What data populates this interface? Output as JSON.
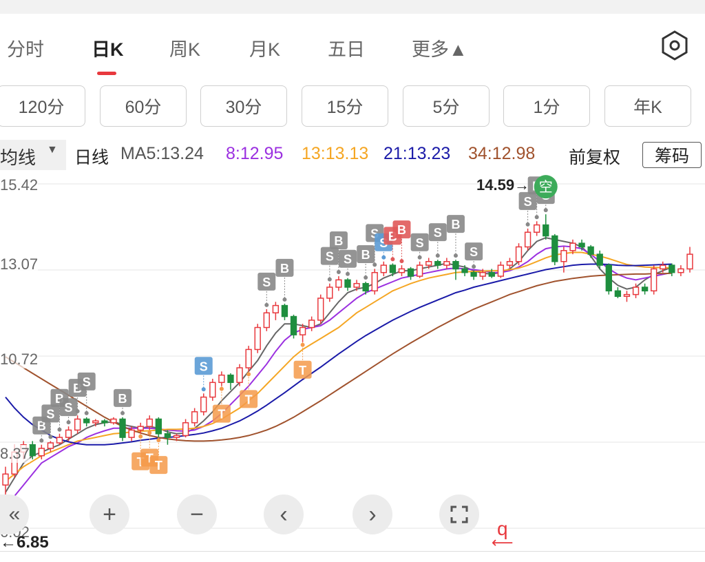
{
  "tabs": [
    "分时",
    "日K",
    "周K",
    "月K",
    "五日",
    "更多▲"
  ],
  "settings_icon": "hexagon-gear-icon",
  "minute_buttons": [
    "120分",
    "60分",
    "30分",
    "15分",
    "5分",
    "1分",
    "年K"
  ],
  "ma_bar": {
    "indicator": "均线",
    "period": "日线",
    "ma5": "MA5:13.24",
    "ma8": "8:12.95",
    "ma13": "13:13.13",
    "ma21": "21:13.23",
    "ma34": "34:12.98",
    "adjust": "前复权",
    "chips_button": "筹码"
  },
  "colors": {
    "ma5": "#666666",
    "ma8": "#9b30e0",
    "ma13": "#f5a623",
    "ma21": "#1a1aa8",
    "ma34": "#a0522d",
    "up": "#e8383d",
    "down": "#1e8e3e",
    "accent": "#e8383d"
  },
  "axis_labels": [
    "15.42",
    "13.07",
    "10.72",
    "8.37",
    "6.02"
  ],
  "high_price": "14.59→",
  "low_price": "←6.85",
  "signal_kong": "空",
  "q_label": "q",
  "nav": {
    "first": "«",
    "zoom_in": "+",
    "zoom_out": "−",
    "prev": "‹",
    "next": "›",
    "fullscreen": "⛶"
  },
  "chart_data": {
    "type": "candlestick",
    "y_range": [
      6.02,
      15.42
    ],
    "ticks": [
      15.42,
      13.07,
      10.72,
      8.37,
      6.02
    ],
    "high": 14.59,
    "low": 6.85,
    "candles": [
      {
        "o": 7.2,
        "c": 7.5,
        "h": 7.7,
        "l": 6.85
      },
      {
        "o": 7.5,
        "c": 8.1,
        "h": 8.3,
        "l": 7.4
      },
      {
        "o": 8.1,
        "c": 8.3,
        "h": 8.4,
        "l": 7.9
      },
      {
        "o": 8.3,
        "c": 8.0,
        "h": 8.4,
        "l": 7.9
      },
      {
        "o": 8.0,
        "c": 8.2,
        "h": 8.3,
        "l": 7.9
      },
      {
        "o": 8.2,
        "c": 8.35,
        "h": 8.4,
        "l": 8.1
      },
      {
        "o": 8.35,
        "c": 8.5,
        "h": 8.6,
        "l": 8.3
      },
      {
        "o": 8.5,
        "c": 8.7,
        "h": 8.8,
        "l": 8.4
      },
      {
        "o": 8.7,
        "c": 9.0,
        "h": 9.1,
        "l": 8.6
      },
      {
        "o": 9.0,
        "c": 8.9,
        "h": 9.05,
        "l": 8.8
      },
      {
        "o": 8.9,
        "c": 8.95,
        "h": 9.0,
        "l": 8.8
      },
      {
        "o": 8.95,
        "c": 8.9,
        "h": 9.0,
        "l": 8.8
      },
      {
        "o": 8.9,
        "c": 9.0,
        "h": 9.05,
        "l": 8.85
      },
      {
        "o": 9.0,
        "c": 8.5,
        "h": 9.05,
        "l": 8.4
      },
      {
        "o": 8.5,
        "c": 8.7,
        "h": 8.8,
        "l": 8.4
      },
      {
        "o": 8.7,
        "c": 8.8,
        "h": 8.9,
        "l": 8.6
      },
      {
        "o": 8.8,
        "c": 9.0,
        "h": 9.1,
        "l": 8.7
      },
      {
        "o": 9.0,
        "c": 8.6,
        "h": 9.05,
        "l": 8.5
      },
      {
        "o": 8.6,
        "c": 8.5,
        "h": 8.7,
        "l": 8.3
      },
      {
        "o": 8.5,
        "c": 8.55,
        "h": 8.6,
        "l": 8.4
      },
      {
        "o": 8.55,
        "c": 8.9,
        "h": 9.0,
        "l": 8.5
      },
      {
        "o": 8.9,
        "c": 9.2,
        "h": 9.3,
        "l": 8.8
      },
      {
        "o": 9.2,
        "c": 9.6,
        "h": 9.7,
        "l": 9.1
      },
      {
        "o": 9.6,
        "c": 10.0,
        "h": 10.1,
        "l": 9.5
      },
      {
        "o": 10.0,
        "c": 10.2,
        "h": 10.3,
        "l": 9.9
      },
      {
        "o": 10.2,
        "c": 10.0,
        "h": 10.25,
        "l": 9.8
      },
      {
        "o": 10.0,
        "c": 10.4,
        "h": 10.5,
        "l": 9.9
      },
      {
        "o": 10.4,
        "c": 10.9,
        "h": 11.0,
        "l": 10.3
      },
      {
        "o": 10.9,
        "c": 11.5,
        "h": 11.6,
        "l": 10.8
      },
      {
        "o": 11.5,
        "c": 11.9,
        "h": 12.0,
        "l": 11.4
      },
      {
        "o": 11.9,
        "c": 12.1,
        "h": 12.2,
        "l": 11.7
      },
      {
        "o": 12.1,
        "c": 11.8,
        "h": 12.15,
        "l": 11.7
      },
      {
        "o": 11.8,
        "c": 11.3,
        "h": 11.85,
        "l": 11.2
      },
      {
        "o": 11.3,
        "c": 11.5,
        "h": 11.6,
        "l": 11.1
      },
      {
        "o": 11.5,
        "c": 11.7,
        "h": 11.8,
        "l": 11.4
      },
      {
        "o": 11.7,
        "c": 12.3,
        "h": 12.4,
        "l": 11.6
      },
      {
        "o": 12.3,
        "c": 12.6,
        "h": 12.7,
        "l": 12.2
      },
      {
        "o": 12.6,
        "c": 12.8,
        "h": 12.9,
        "l": 12.5
      },
      {
        "o": 12.8,
        "c": 12.6,
        "h": 12.85,
        "l": 12.5
      },
      {
        "o": 12.6,
        "c": 12.7,
        "h": 12.8,
        "l": 12.5
      },
      {
        "o": 12.7,
        "c": 12.5,
        "h": 12.75,
        "l": 12.4
      },
      {
        "o": 12.5,
        "c": 13.0,
        "h": 13.1,
        "l": 12.4
      },
      {
        "o": 13.0,
        "c": 13.2,
        "h": 13.3,
        "l": 12.9
      },
      {
        "o": 13.2,
        "c": 13.0,
        "h": 13.25,
        "l": 12.9
      },
      {
        "o": 13.0,
        "c": 13.1,
        "h": 13.2,
        "l": 12.9
      },
      {
        "o": 13.1,
        "c": 12.9,
        "h": 13.15,
        "l": 12.8
      },
      {
        "o": 12.9,
        "c": 13.2,
        "h": 13.3,
        "l": 12.85
      },
      {
        "o": 13.2,
        "c": 13.3,
        "h": 13.4,
        "l": 13.1
      },
      {
        "o": 13.3,
        "c": 13.2,
        "h": 13.35,
        "l": 13.1
      },
      {
        "o": 13.2,
        "c": 13.3,
        "h": 13.4,
        "l": 13.1
      },
      {
        "o": 13.3,
        "c": 13.1,
        "h": 13.35,
        "l": 12.8
      },
      {
        "o": 13.1,
        "c": 13.0,
        "h": 13.2,
        "l": 12.9
      },
      {
        "o": 13.0,
        "c": 12.9,
        "h": 13.05,
        "l": 12.8
      },
      {
        "o": 12.9,
        "c": 13.0,
        "h": 13.1,
        "l": 12.8
      },
      {
        "o": 13.0,
        "c": 12.9,
        "h": 13.1,
        "l": 12.85
      },
      {
        "o": 12.9,
        "c": 13.2,
        "h": 13.3,
        "l": 12.85
      },
      {
        "o": 13.2,
        "c": 13.3,
        "h": 13.4,
        "l": 13.1
      },
      {
        "o": 13.3,
        "c": 13.7,
        "h": 13.8,
        "l": 13.2
      },
      {
        "o": 13.7,
        "c": 14.1,
        "h": 14.2,
        "l": 13.6
      },
      {
        "o": 14.1,
        "c": 14.3,
        "h": 14.4,
        "l": 14.0
      },
      {
        "o": 14.3,
        "c": 14.0,
        "h": 14.59,
        "l": 13.9
      },
      {
        "o": 14.0,
        "c": 13.3,
        "h": 14.05,
        "l": 13.2
      },
      {
        "o": 13.3,
        "c": 13.6,
        "h": 13.7,
        "l": 13.0
      },
      {
        "o": 13.6,
        "c": 13.8,
        "h": 13.9,
        "l": 13.5
      },
      {
        "o": 13.8,
        "c": 13.7,
        "h": 13.9,
        "l": 13.6
      },
      {
        "o": 13.7,
        "c": 13.5,
        "h": 13.75,
        "l": 13.4
      },
      {
        "o": 13.5,
        "c": 13.2,
        "h": 13.6,
        "l": 13.1
      },
      {
        "o": 13.2,
        "c": 12.5,
        "h": 13.25,
        "l": 12.4
      },
      {
        "o": 12.5,
        "c": 12.35,
        "h": 12.6,
        "l": 12.3
      },
      {
        "o": 12.35,
        "c": 12.4,
        "h": 12.5,
        "l": 12.2
      },
      {
        "o": 12.4,
        "c": 12.6,
        "h": 12.7,
        "l": 12.3
      },
      {
        "o": 12.6,
        "c": 12.5,
        "h": 12.7,
        "l": 12.4
      },
      {
        "o": 12.5,
        "c": 13.1,
        "h": 13.2,
        "l": 12.4
      },
      {
        "o": 13.1,
        "c": 13.2,
        "h": 13.3,
        "l": 13.0
      },
      {
        "o": 13.2,
        "c": 13.0,
        "h": 13.25,
        "l": 12.9
      },
      {
        "o": 13.0,
        "c": 13.1,
        "h": 13.2,
        "l": 12.9
      },
      {
        "o": 13.1,
        "c": 13.5,
        "h": 13.7,
        "l": 13.0
      }
    ],
    "ma_lines": [
      {
        "name": "MA5",
        "values": [
          7.0,
          7.4,
          7.8,
          8.0,
          8.1,
          8.2,
          8.3,
          8.45,
          8.6,
          8.75,
          8.85,
          8.9,
          8.93,
          8.85,
          8.8,
          8.75,
          8.8,
          8.75,
          8.65,
          8.6,
          8.62,
          8.75,
          8.95,
          9.2,
          9.5,
          9.75,
          10.0,
          10.3,
          10.6,
          11.0,
          11.35,
          11.6,
          11.6,
          11.55,
          11.5,
          11.6,
          11.9,
          12.2,
          12.45,
          12.55,
          12.6,
          12.7,
          12.85,
          12.95,
          13.05,
          13.05,
          13.1,
          13.15,
          13.2,
          13.25,
          13.2,
          13.15,
          13.05,
          12.98,
          12.96,
          13.0,
          13.1,
          13.3,
          13.6,
          13.85,
          13.95,
          13.9,
          13.85,
          13.8,
          13.7,
          13.45,
          13.1,
          12.85,
          12.65,
          12.55,
          12.6,
          12.8,
          12.95,
          13.05,
          13.15
        ]
      },
      {
        "name": "MA8",
        "values": [
          6.6,
          6.9,
          7.2,
          7.5,
          7.8,
          7.95,
          8.1,
          8.25,
          8.35,
          8.5,
          8.6,
          8.68,
          8.75,
          8.75,
          8.75,
          8.75,
          8.75,
          8.73,
          8.7,
          8.68,
          8.67,
          8.7,
          8.8,
          8.95,
          9.15,
          9.4,
          9.65,
          9.9,
          10.2,
          10.5,
          10.85,
          11.15,
          11.35,
          11.45,
          11.5,
          11.55,
          11.7,
          11.9,
          12.1,
          12.3,
          12.45,
          12.55,
          12.65,
          12.75,
          12.85,
          12.9,
          12.95,
          13.0,
          13.05,
          13.1,
          13.12,
          13.1,
          13.08,
          13.05,
          13.0,
          13.0,
          13.05,
          13.15,
          13.3,
          13.5,
          13.65,
          13.7,
          13.72,
          13.7,
          13.65,
          13.5,
          13.3,
          13.1,
          12.95,
          12.85,
          12.8,
          12.85,
          12.9,
          12.95,
          13.0
        ]
      },
      {
        "name": "MA13",
        "values": [
          7.3,
          7.5,
          7.7,
          7.85,
          8.0,
          8.1,
          8.2,
          8.3,
          8.4,
          8.45,
          8.5,
          8.55,
          8.6,
          8.62,
          8.65,
          8.67,
          8.68,
          8.7,
          8.72,
          8.72,
          8.73,
          8.75,
          8.8,
          8.88,
          9.0,
          9.15,
          9.3,
          9.5,
          9.7,
          9.95,
          10.2,
          10.45,
          10.7,
          10.9,
          11.05,
          11.2,
          11.35,
          11.5,
          11.7,
          11.9,
          12.05,
          12.2,
          12.35,
          12.5,
          12.6,
          12.7,
          12.78,
          12.85,
          12.9,
          12.95,
          13.0,
          13.02,
          13.03,
          13.04,
          13.05,
          13.05,
          13.08,
          13.12,
          13.2,
          13.3,
          13.4,
          13.48,
          13.52,
          13.55,
          13.55,
          13.5,
          13.45,
          13.38,
          13.3,
          13.22,
          13.18,
          13.15,
          13.14,
          13.13,
          13.13
        ]
      },
      {
        "name": "MA21",
        "values": [
          9.6,
          9.3,
          9.05,
          8.85,
          8.7,
          8.55,
          8.45,
          8.38,
          8.33,
          8.3,
          8.3,
          8.3,
          8.32,
          8.35,
          8.38,
          8.42,
          8.45,
          8.48,
          8.5,
          8.52,
          8.55,
          8.58,
          8.62,
          8.68,
          8.75,
          8.85,
          8.95,
          9.08,
          9.22,
          9.38,
          9.55,
          9.72,
          9.9,
          10.08,
          10.25,
          10.42,
          10.6,
          10.78,
          10.95,
          11.12,
          11.28,
          11.42,
          11.56,
          11.7,
          11.82,
          11.94,
          12.05,
          12.15,
          12.25,
          12.35,
          12.45,
          12.52,
          12.6,
          12.66,
          12.72,
          12.78,
          12.84,
          12.9,
          12.96,
          13.02,
          13.08,
          13.12,
          13.16,
          13.2,
          13.22,
          13.23,
          13.23,
          13.22,
          13.2,
          13.19,
          13.19,
          13.2,
          13.21,
          13.22,
          13.23
        ]
      },
      {
        "name": "MA34",
        "values": [
          10.7,
          10.55,
          10.4,
          10.25,
          10.1,
          9.95,
          9.8,
          9.65,
          9.5,
          9.35,
          9.2,
          9.05,
          8.92,
          8.8,
          8.7,
          8.62,
          8.55,
          8.5,
          8.46,
          8.43,
          8.41,
          8.4,
          8.4,
          8.41,
          8.43,
          8.46,
          8.5,
          8.55,
          8.62,
          8.7,
          8.8,
          8.92,
          9.05,
          9.2,
          9.35,
          9.5,
          9.66,
          9.82,
          9.98,
          10.14,
          10.3,
          10.46,
          10.62,
          10.78,
          10.93,
          11.08,
          11.22,
          11.36,
          11.5,
          11.63,
          11.76,
          11.88,
          12.0,
          12.1,
          12.2,
          12.3,
          12.4,
          12.48,
          12.56,
          12.64,
          12.7,
          12.76,
          12.8,
          12.84,
          12.87,
          12.9,
          12.92,
          12.93,
          12.94,
          12.95,
          12.96,
          12.96,
          12.97,
          12.97,
          12.98
        ]
      }
    ],
    "signals": [
      {
        "i": 4,
        "t": "B",
        "c": "#888888"
      },
      {
        "i": 5,
        "t": "S",
        "c": "#888888"
      },
      {
        "i": 6,
        "t": "B",
        "c": "#888888"
      },
      {
        "i": 7,
        "t": "S",
        "c": "#888888"
      },
      {
        "i": 8,
        "t": "B",
        "c": "#888888"
      },
      {
        "i": 9,
        "t": "S",
        "c": "#888888"
      },
      {
        "i": 13,
        "t": "B",
        "c": "#888888"
      },
      {
        "i": 15,
        "t": "T",
        "c": "#f59a4a"
      },
      {
        "i": 16,
        "t": "T",
        "c": "#f59a4a"
      },
      {
        "i": 17,
        "t": "T",
        "c": "#f59a4a"
      },
      {
        "i": 22,
        "t": "S",
        "c": "#5b9bd5"
      },
      {
        "i": 24,
        "t": "T",
        "c": "#f59a4a"
      },
      {
        "i": 27,
        "t": "T",
        "c": "#f59a4a"
      },
      {
        "i": 29,
        "t": "S",
        "c": "#888888"
      },
      {
        "i": 31,
        "t": "B",
        "c": "#888888"
      },
      {
        "i": 33,
        "t": "T",
        "c": "#f59a4a"
      },
      {
        "i": 36,
        "t": "S",
        "c": "#888888"
      },
      {
        "i": 37,
        "t": "B",
        "c": "#888888"
      },
      {
        "i": 38,
        "t": "S",
        "c": "#888888"
      },
      {
        "i": 40,
        "t": "B",
        "c": "#888888"
      },
      {
        "i": 41,
        "t": "S",
        "c": "#888888"
      },
      {
        "i": 42,
        "t": "S",
        "c": "#5b9bd5"
      },
      {
        "i": 43,
        "t": "B",
        "c": "#e05a5a"
      },
      {
        "i": 44,
        "t": "B",
        "c": "#e05a5a"
      },
      {
        "i": 46,
        "t": "S",
        "c": "#888888"
      },
      {
        "i": 48,
        "t": "S",
        "c": "#888888"
      },
      {
        "i": 50,
        "t": "B",
        "c": "#888888"
      },
      {
        "i": 52,
        "t": "S",
        "c": "#888888"
      },
      {
        "i": 58,
        "t": "S",
        "c": "#888888"
      },
      {
        "i": 59,
        "t": "B",
        "c": "#888888"
      },
      {
        "i": 60,
        "t": "S",
        "c": "#888888"
      }
    ]
  }
}
